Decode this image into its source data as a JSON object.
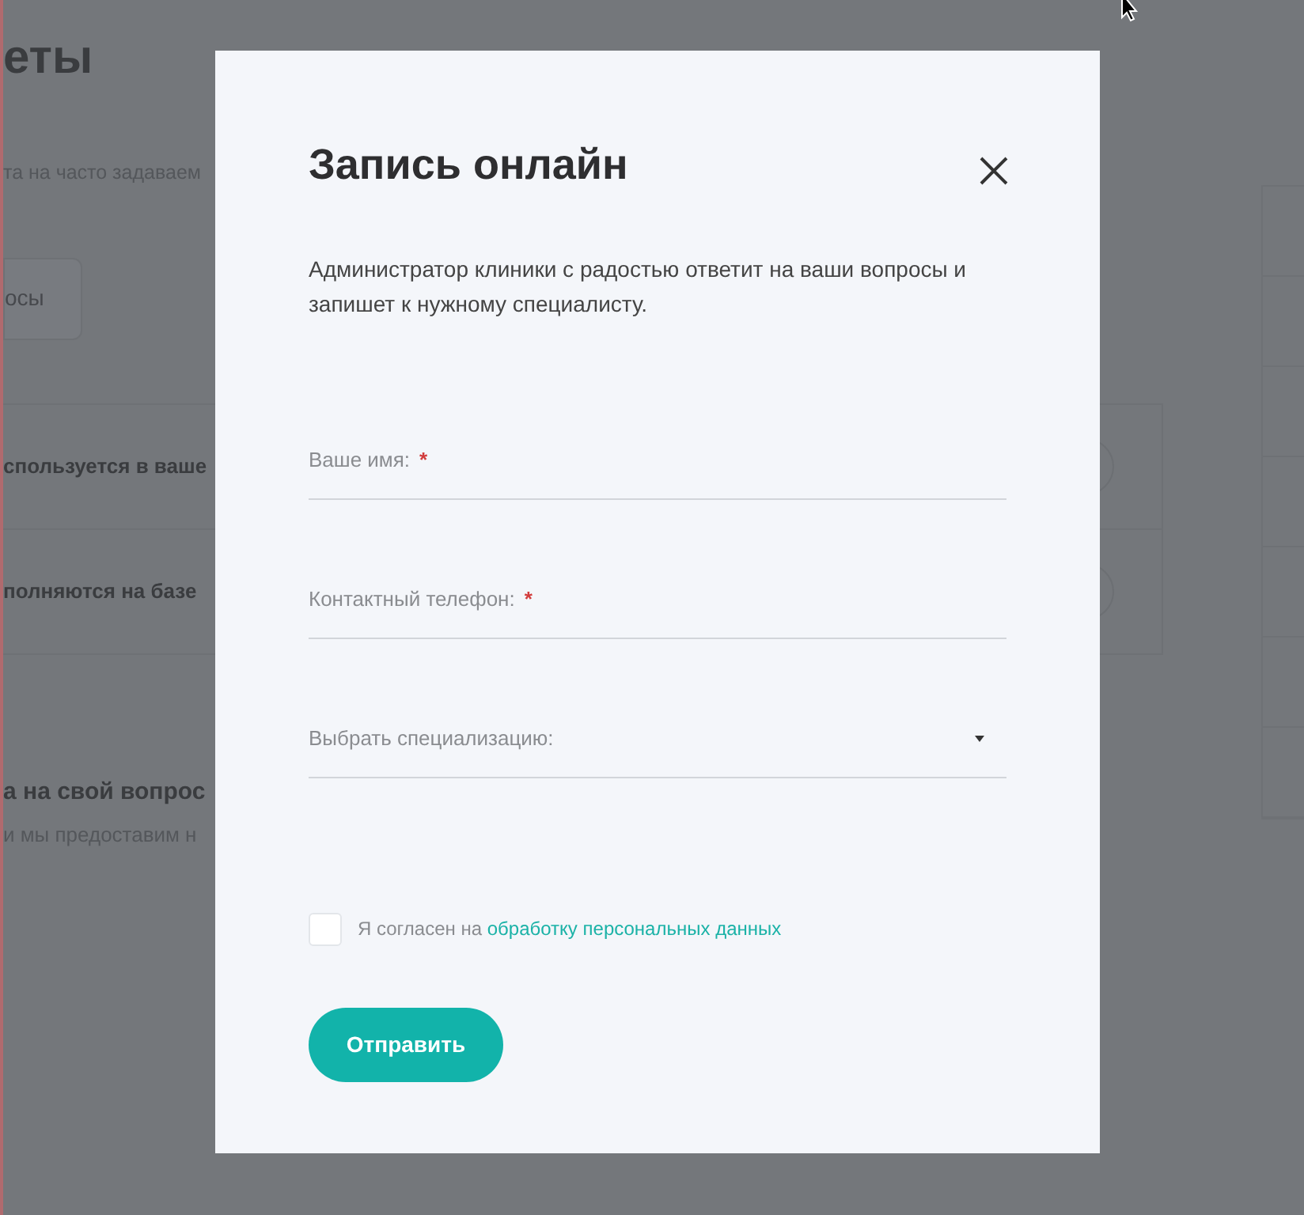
{
  "background_page": {
    "heading": "еты",
    "subtitle": "та на часто задаваем",
    "tab": "осы",
    "faq": [
      {
        "question": "спользуется в ваше"
      },
      {
        "question": "полняются на базе"
      }
    ],
    "ask": {
      "heading": "а на свой вопрос",
      "text": "и мы предоставим н"
    }
  },
  "modal": {
    "title": "Запись онлайн",
    "description": "Администратор клиники с радостью ответит на ваши вопросы и запишет к нужному специалисту.",
    "fields": [
      {
        "kind": "text",
        "label": "Ваше имя:",
        "required_mark": "*"
      },
      {
        "kind": "text",
        "label": "Контактный телефон:",
        "required_mark": "*"
      },
      {
        "kind": "select",
        "label": "Выбрать специализацию:"
      }
    ],
    "consent": {
      "checked": false,
      "text": "Я согласен на",
      "link": "обработку персональных данных"
    },
    "submit": "Отправить"
  }
}
